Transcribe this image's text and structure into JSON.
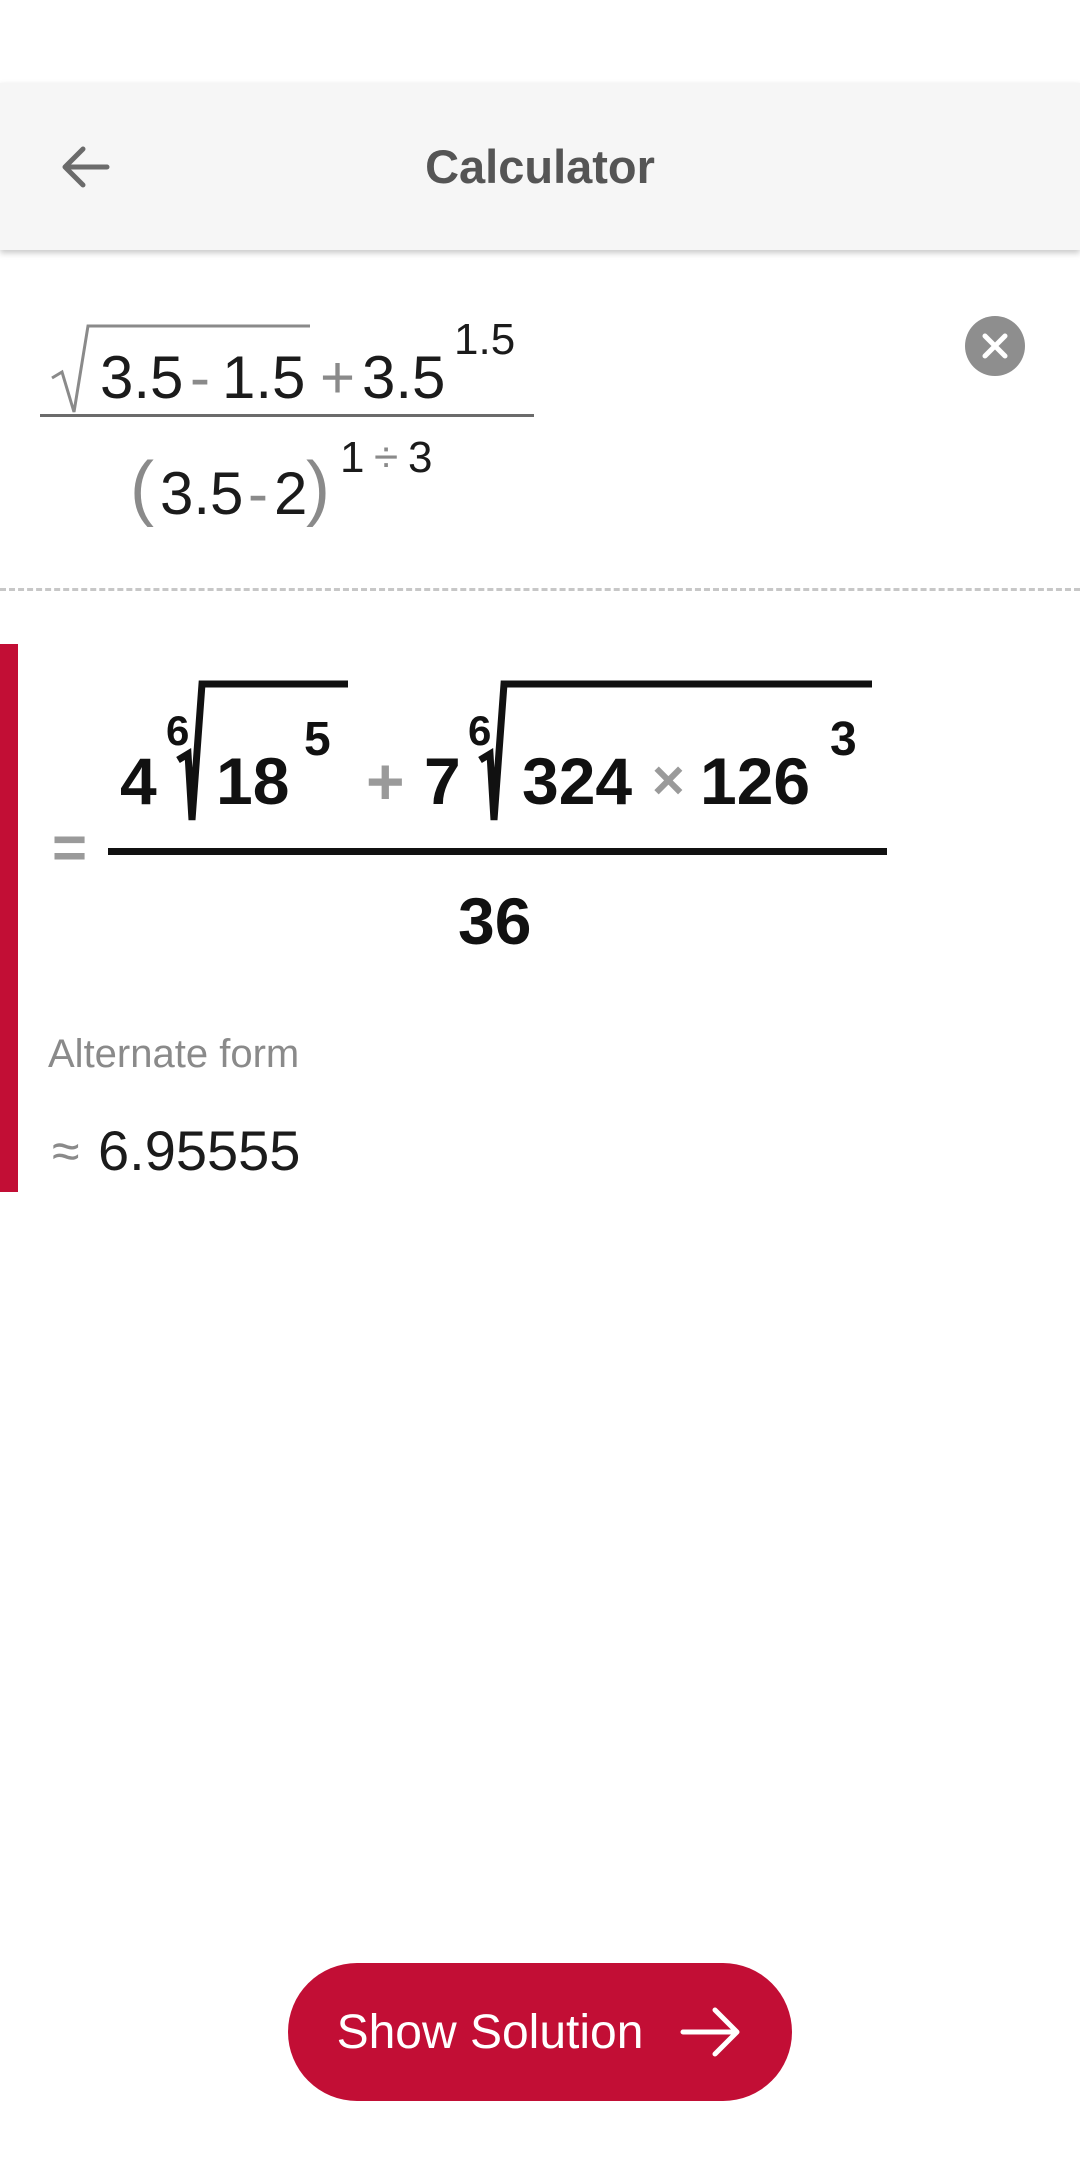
{
  "toolbar": {
    "title": "Calculator",
    "back_icon": "arrow-left-icon"
  },
  "input_expression": {
    "sqrt_arg_a": "3.5",
    "minus": "-",
    "sqrt_arg_b": "1.5",
    "plus": "+",
    "power_base": "3.5",
    "power_exp": "1.5",
    "open_paren": "(",
    "den_a": "3.5",
    "den_minus": "-",
    "den_b": "2",
    "close_paren": ")",
    "den_exp_a": "1",
    "den_exp_op": "÷",
    "den_exp_b": "3",
    "clear_icon": "close-circle-icon"
  },
  "result": {
    "equals": "=",
    "coef1": "4",
    "root1_index": "6",
    "root1_base": "18",
    "root1_exp": "5",
    "plus": "+",
    "coef2": "7",
    "root2_index": "6",
    "root2_a": "324",
    "times": "×",
    "root2_b": "126",
    "root2_exp": "3",
    "denominator": "36"
  },
  "alternate": {
    "label": "Alternate form",
    "approx_symbol": "≈",
    "value": "6.95555"
  },
  "show_solution": {
    "label": "Show Solution",
    "icon": "arrow-right-icon"
  },
  "colors": {
    "accent": "#c20e35",
    "toolbar_bg": "#f6f6f6",
    "operator_gray": "#8a8a8a"
  }
}
